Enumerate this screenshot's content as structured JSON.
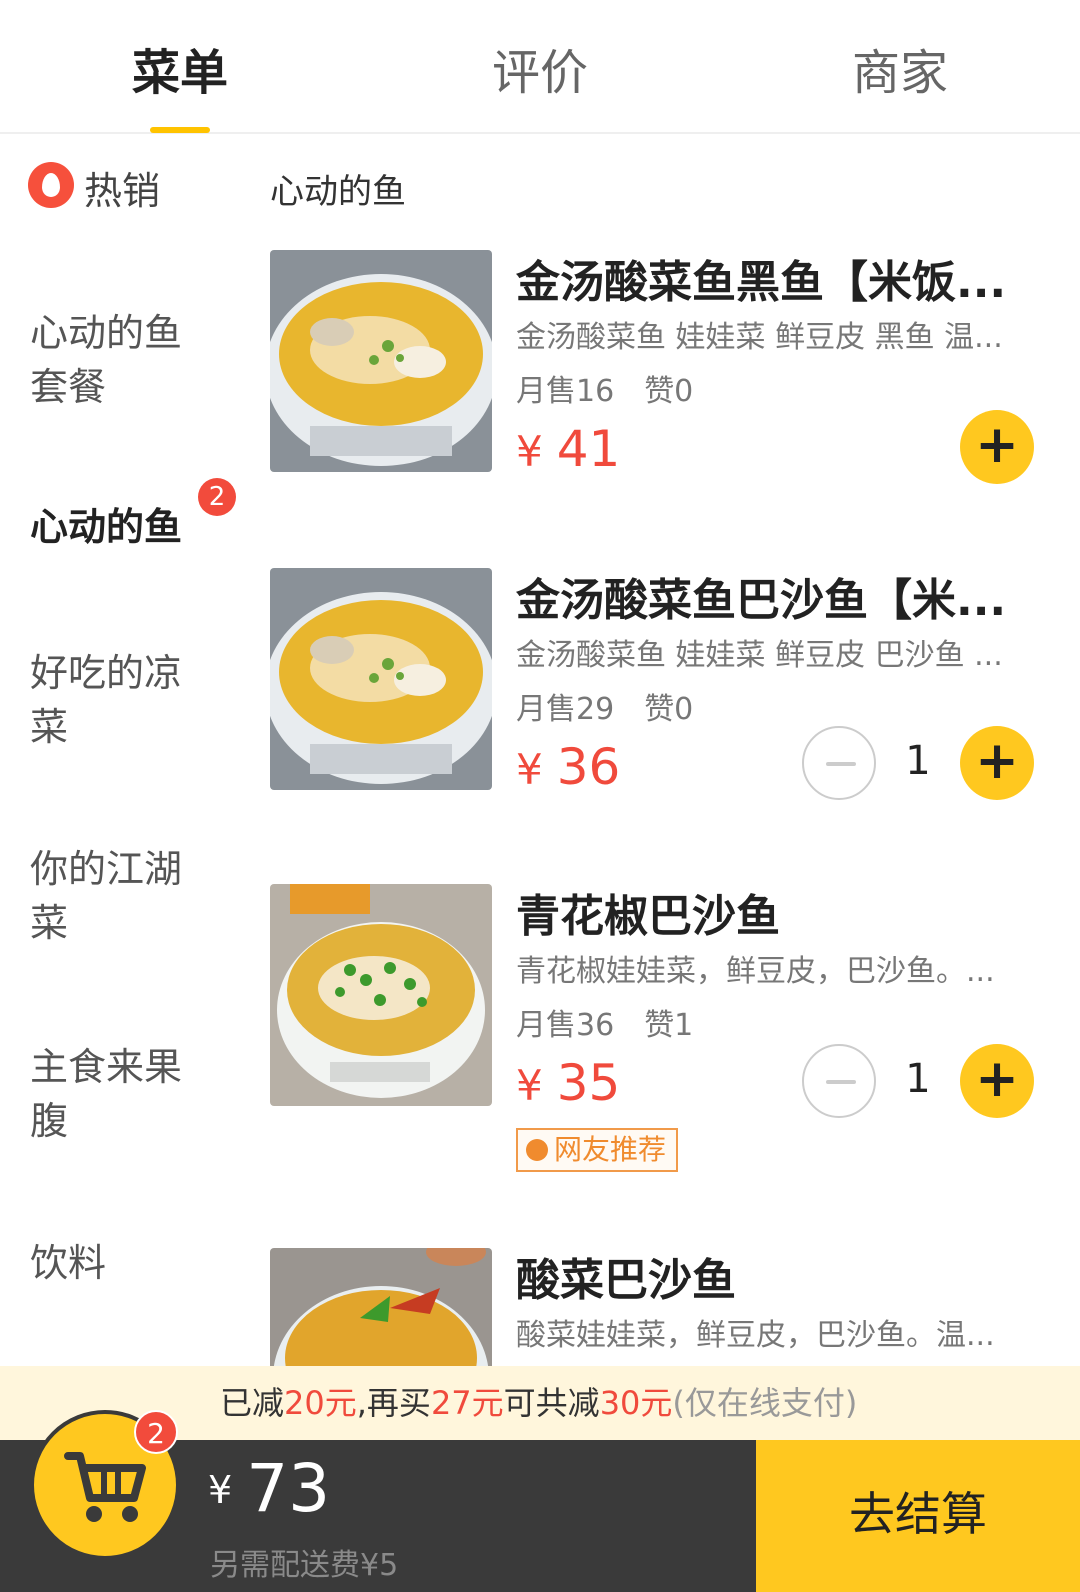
{
  "tabs": [
    {
      "label": "菜单",
      "active": true
    },
    {
      "label": "评价",
      "active": false
    },
    {
      "label": "商家",
      "active": false
    }
  ],
  "sidebar": {
    "hot_label": "热销",
    "items": [
      {
        "label": "心动的鱼套餐",
        "lines": [
          "心动的鱼",
          "套餐"
        ],
        "active": false
      },
      {
        "label": "心动的鱼",
        "lines": [
          "心动的鱼"
        ],
        "active": true,
        "badge": "2"
      },
      {
        "label": "好吃的凉菜",
        "lines": [
          "好吃的凉",
          "菜"
        ],
        "active": false
      },
      {
        "label": "你的江湖菜",
        "lines": [
          "你的江湖",
          "菜"
        ],
        "active": false
      },
      {
        "label": "主食来果腹",
        "lines": [
          "主食来果",
          "腹"
        ],
        "active": false
      },
      {
        "label": "饮料",
        "lines": [
          "饮料"
        ],
        "active": false
      }
    ]
  },
  "section_title": "心动的鱼",
  "currency": "¥",
  "items": [
    {
      "name": "金汤酸菜鱼黑鱼【米饭...",
      "desc": "金汤酸菜鱼 娃娃菜 鲜豆皮 黑鱼 温...",
      "sold": "月售16",
      "likes": "赞0",
      "price": "41",
      "qty": null,
      "tag": null
    },
    {
      "name": "金汤酸菜鱼巴沙鱼【米...",
      "desc": "金汤酸菜鱼 娃娃菜 鲜豆皮 巴沙鱼 ...",
      "sold": "月售29",
      "likes": "赞0",
      "price": "36",
      "qty": "1",
      "tag": null
    },
    {
      "name": "青花椒巴沙鱼",
      "desc": "青花椒娃娃菜，鲜豆皮，巴沙鱼。...",
      "sold": "月售36",
      "likes": "赞1",
      "price": "35",
      "qty": "1",
      "tag": "网友推荐"
    },
    {
      "name": "酸菜巴沙鱼",
      "desc": "酸菜娃娃菜，鲜豆皮，巴沙鱼。温...",
      "sold": "",
      "likes": "",
      "price": "",
      "qty": null,
      "tag": null
    }
  ],
  "promo": {
    "p1": "已减",
    "v1": "20元",
    "p2": ",再买",
    "v2": "27元",
    "p3": "可共减",
    "v3": "30元",
    "note": "(仅在线支付)"
  },
  "cart": {
    "count": "2",
    "currency": "¥",
    "total": "73",
    "delivery": "另需配送费¥5",
    "checkout_label": "去结算"
  },
  "colors": {
    "accent": "#ffc81f",
    "price": "#f04a3c",
    "cart_bar": "#3a3a3a",
    "promo_bg": "#fff6dc"
  },
  "icons": [
    "fire-icon",
    "plus-icon",
    "minus-icon",
    "cart-icon",
    "recommend-icon"
  ]
}
